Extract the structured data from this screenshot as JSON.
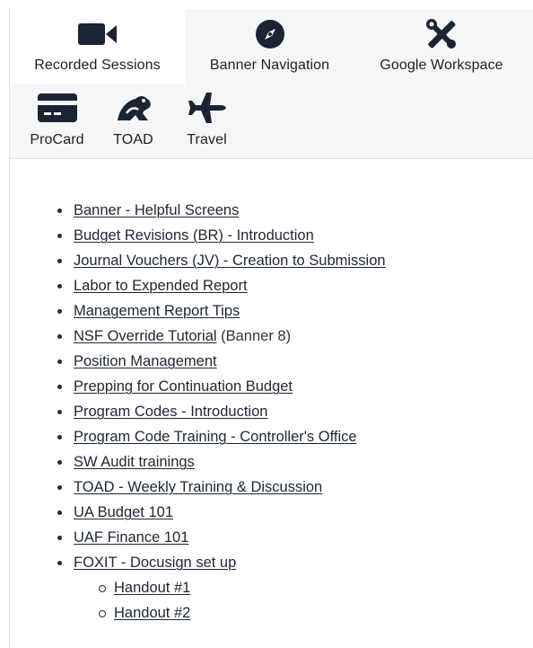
{
  "tabs": {
    "recorded": {
      "label": "Recorded Sessions",
      "icon": "video-camera-icon",
      "active": true
    },
    "banner": {
      "label": "Banner Navigation",
      "icon": "compass-icon"
    },
    "google": {
      "label": "Google Workspace",
      "icon": "tools-icon"
    },
    "procard": {
      "label": "ProCard",
      "icon": "credit-card-icon"
    },
    "toad": {
      "label": "TOAD",
      "icon": "frog-icon"
    },
    "travel": {
      "label": "Travel",
      "icon": "airplane-icon"
    }
  },
  "links": [
    {
      "label": "Banner - Helpful Screens"
    },
    {
      "label": "Budget Revisions (BR) - Introduction"
    },
    {
      "label": "Journal Vouchers (JV) - Creation to Submission"
    },
    {
      "label": "Labor to Expended Report"
    },
    {
      "label": "Management Report Tips"
    },
    {
      "label": "NSF Override Tutorial",
      "suffix": " (Banner 8)"
    },
    {
      "label": "Position Management"
    },
    {
      "label": "Prepping for Continuation Budget"
    },
    {
      "label": "Program Codes - Introduction"
    },
    {
      "label": "Program Code Training - Controller's Office"
    },
    {
      "label": "SW Audit trainings"
    },
    {
      "label": "TOAD - Weekly Training & Discussion"
    },
    {
      "label": "UA Budget 101"
    },
    {
      "label": "UAF Finance 101"
    },
    {
      "label": "FOXIT - Docusign set up",
      "children": [
        {
          "label": "Handout #1"
        },
        {
          "label": "Handout #2"
        }
      ]
    }
  ],
  "colors": {
    "icon": "#1b2433",
    "tabbar_bg": "#f4f6f8",
    "link": "#1d2735"
  }
}
